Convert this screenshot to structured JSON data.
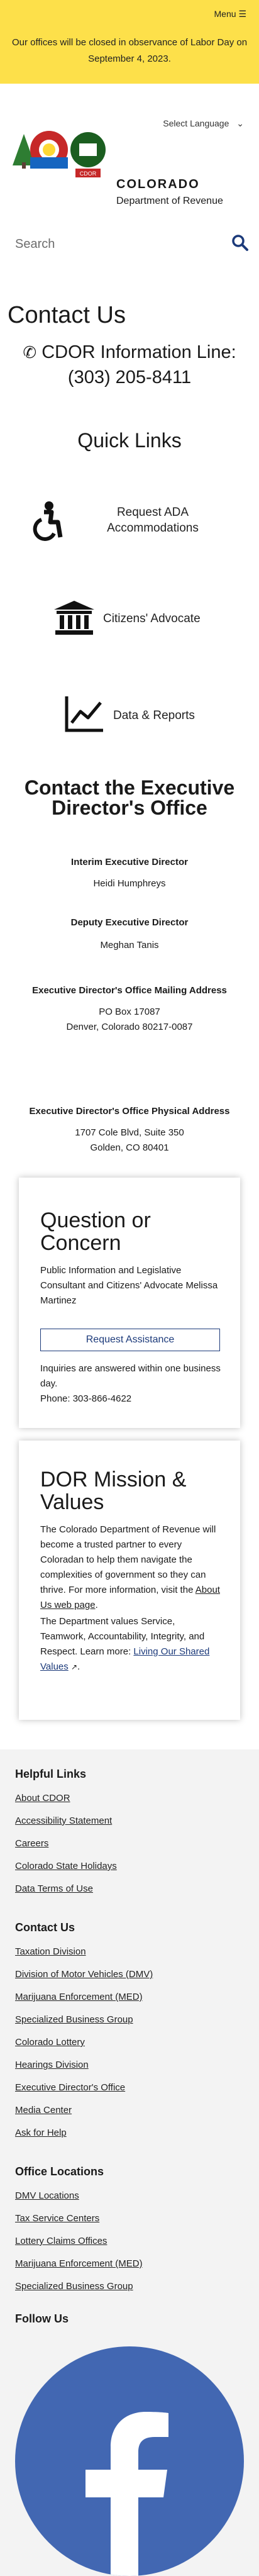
{
  "header": {
    "menu_label": "Menu",
    "alert": "Our offices will be closed in observance of Labor Day on September 4, 2023.",
    "language_select": "Select Language"
  },
  "logo": {
    "title": "COLORADO",
    "subtitle": "Department of Revenue",
    "badge": "CDOR"
  },
  "search": {
    "placeholder": "Search"
  },
  "contact": {
    "title": "Contact Us",
    "phone_line1": "CDOR Information Line:",
    "phone_line2": "(303) 205-8411"
  },
  "quick_links": {
    "title": "Quick Links",
    "items": [
      {
        "label": "Request ADA Accommodations",
        "icon": "accessibility-icon"
      },
      {
        "label": "Citizens' Advocate",
        "icon": "building-icon"
      },
      {
        "label": "Data & Reports",
        "icon": "chart-line-icon"
      }
    ]
  },
  "exec": {
    "title": "Contact the Executive Director's Office",
    "interim_label": "Interim Executive Director",
    "interim_name": "Heidi Humphreys",
    "deputy_label": "Deputy Executive Director",
    "deputy_name": "Meghan Tanis",
    "mailing_label": "Executive Director's Office Mailing Address",
    "mailing_line1": "PO Box 17087",
    "mailing_line2": "Denver, Colorado 80217-0087",
    "physical_label": "Executive Director's Office Physical Address",
    "physical_line1": "1707 Cole Blvd, Suite 350",
    "physical_line2": "Golden, CO 80401"
  },
  "question": {
    "title": "Question or Concern",
    "body": "Public Information and Legislative Consultant and Citizens' Advocate Melissa Martinez",
    "button": "Request Assistance",
    "note": "Inquiries are answered within one business day.",
    "phone": "Phone: 303-866-4622"
  },
  "mission": {
    "title": "DOR Mission & Values",
    "body": "The Colorado Department of Revenue will become a trusted partner to every Coloradan to help them navigate the complexities of government so they can thrive. For more information, visit the",
    "link1": "About Us web page",
    "values": "The Department values Service, Teamwork, Accountability, Integrity, and Respect. Learn more:",
    "link2": "Living Our Shared Values"
  },
  "footer": {
    "helpful_title": "Helpful Links",
    "helpful": [
      "About CDOR",
      "Accessibility Statement",
      "Careers",
      "Colorado State Holidays",
      "Data Terms of Use"
    ],
    "contact_title": "Contact Us",
    "contact": [
      "Taxation Division",
      "Division of Motor Vehicles (DMV)",
      "Marijuana Enforcement (MED)",
      "Specialized Business Group",
      "Colorado Lottery",
      "Hearings Division",
      "Executive Director's Office",
      "Media Center",
      "Ask for Help"
    ],
    "offices_title": "Office Locations",
    "offices": [
      "DMV Locations",
      "Tax Service Centers",
      "Lottery Claims Offices",
      "Marijuana Enforcement (MED)",
      "Specialized Business Group"
    ],
    "follow_title": "Follow Us"
  },
  "colors": {
    "alert_bg": "#fde04a",
    "link_blue": "#1c3a7a",
    "facebook": "#4267b2",
    "footer_bg": "#f3f3f3"
  }
}
